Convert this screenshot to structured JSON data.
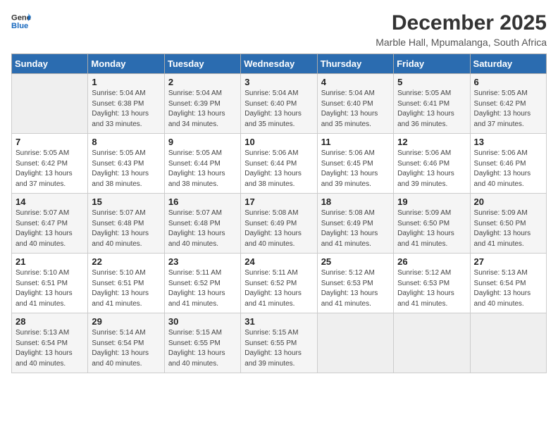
{
  "header": {
    "logo_line1": "General",
    "logo_line2": "Blue",
    "month_year": "December 2025",
    "location": "Marble Hall, Mpumalanga, South Africa"
  },
  "days_of_week": [
    "Sunday",
    "Monday",
    "Tuesday",
    "Wednesday",
    "Thursday",
    "Friday",
    "Saturday"
  ],
  "weeks": [
    [
      {
        "num": "",
        "info": ""
      },
      {
        "num": "1",
        "info": "Sunrise: 5:04 AM\nSunset: 6:38 PM\nDaylight: 13 hours\nand 33 minutes."
      },
      {
        "num": "2",
        "info": "Sunrise: 5:04 AM\nSunset: 6:39 PM\nDaylight: 13 hours\nand 34 minutes."
      },
      {
        "num": "3",
        "info": "Sunrise: 5:04 AM\nSunset: 6:40 PM\nDaylight: 13 hours\nand 35 minutes."
      },
      {
        "num": "4",
        "info": "Sunrise: 5:04 AM\nSunset: 6:40 PM\nDaylight: 13 hours\nand 35 minutes."
      },
      {
        "num": "5",
        "info": "Sunrise: 5:05 AM\nSunset: 6:41 PM\nDaylight: 13 hours\nand 36 minutes."
      },
      {
        "num": "6",
        "info": "Sunrise: 5:05 AM\nSunset: 6:42 PM\nDaylight: 13 hours\nand 37 minutes."
      }
    ],
    [
      {
        "num": "7",
        "info": "Sunrise: 5:05 AM\nSunset: 6:42 PM\nDaylight: 13 hours\nand 37 minutes."
      },
      {
        "num": "8",
        "info": "Sunrise: 5:05 AM\nSunset: 6:43 PM\nDaylight: 13 hours\nand 38 minutes."
      },
      {
        "num": "9",
        "info": "Sunrise: 5:05 AM\nSunset: 6:44 PM\nDaylight: 13 hours\nand 38 minutes."
      },
      {
        "num": "10",
        "info": "Sunrise: 5:06 AM\nSunset: 6:44 PM\nDaylight: 13 hours\nand 38 minutes."
      },
      {
        "num": "11",
        "info": "Sunrise: 5:06 AM\nSunset: 6:45 PM\nDaylight: 13 hours\nand 39 minutes."
      },
      {
        "num": "12",
        "info": "Sunrise: 5:06 AM\nSunset: 6:46 PM\nDaylight: 13 hours\nand 39 minutes."
      },
      {
        "num": "13",
        "info": "Sunrise: 5:06 AM\nSunset: 6:46 PM\nDaylight: 13 hours\nand 40 minutes."
      }
    ],
    [
      {
        "num": "14",
        "info": "Sunrise: 5:07 AM\nSunset: 6:47 PM\nDaylight: 13 hours\nand 40 minutes."
      },
      {
        "num": "15",
        "info": "Sunrise: 5:07 AM\nSunset: 6:48 PM\nDaylight: 13 hours\nand 40 minutes."
      },
      {
        "num": "16",
        "info": "Sunrise: 5:07 AM\nSunset: 6:48 PM\nDaylight: 13 hours\nand 40 minutes."
      },
      {
        "num": "17",
        "info": "Sunrise: 5:08 AM\nSunset: 6:49 PM\nDaylight: 13 hours\nand 40 minutes."
      },
      {
        "num": "18",
        "info": "Sunrise: 5:08 AM\nSunset: 6:49 PM\nDaylight: 13 hours\nand 41 minutes."
      },
      {
        "num": "19",
        "info": "Sunrise: 5:09 AM\nSunset: 6:50 PM\nDaylight: 13 hours\nand 41 minutes."
      },
      {
        "num": "20",
        "info": "Sunrise: 5:09 AM\nSunset: 6:50 PM\nDaylight: 13 hours\nand 41 minutes."
      }
    ],
    [
      {
        "num": "21",
        "info": "Sunrise: 5:10 AM\nSunset: 6:51 PM\nDaylight: 13 hours\nand 41 minutes."
      },
      {
        "num": "22",
        "info": "Sunrise: 5:10 AM\nSunset: 6:51 PM\nDaylight: 13 hours\nand 41 minutes."
      },
      {
        "num": "23",
        "info": "Sunrise: 5:11 AM\nSunset: 6:52 PM\nDaylight: 13 hours\nand 41 minutes."
      },
      {
        "num": "24",
        "info": "Sunrise: 5:11 AM\nSunset: 6:52 PM\nDaylight: 13 hours\nand 41 minutes."
      },
      {
        "num": "25",
        "info": "Sunrise: 5:12 AM\nSunset: 6:53 PM\nDaylight: 13 hours\nand 41 minutes."
      },
      {
        "num": "26",
        "info": "Sunrise: 5:12 AM\nSunset: 6:53 PM\nDaylight: 13 hours\nand 41 minutes."
      },
      {
        "num": "27",
        "info": "Sunrise: 5:13 AM\nSunset: 6:54 PM\nDaylight: 13 hours\nand 40 minutes."
      }
    ],
    [
      {
        "num": "28",
        "info": "Sunrise: 5:13 AM\nSunset: 6:54 PM\nDaylight: 13 hours\nand 40 minutes."
      },
      {
        "num": "29",
        "info": "Sunrise: 5:14 AM\nSunset: 6:54 PM\nDaylight: 13 hours\nand 40 minutes."
      },
      {
        "num": "30",
        "info": "Sunrise: 5:15 AM\nSunset: 6:55 PM\nDaylight: 13 hours\nand 40 minutes."
      },
      {
        "num": "31",
        "info": "Sunrise: 5:15 AM\nSunset: 6:55 PM\nDaylight: 13 hours\nand 39 minutes."
      },
      {
        "num": "",
        "info": ""
      },
      {
        "num": "",
        "info": ""
      },
      {
        "num": "",
        "info": ""
      }
    ]
  ]
}
